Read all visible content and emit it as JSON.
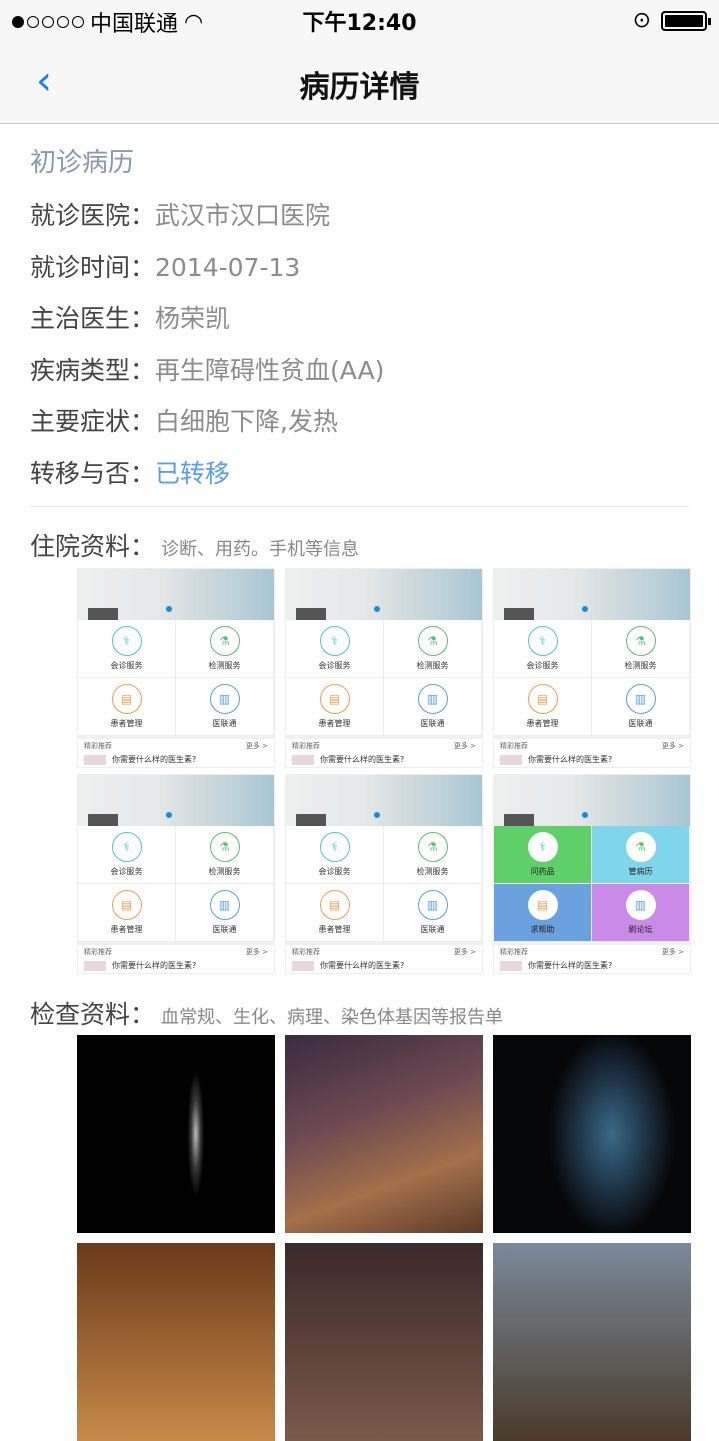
{
  "status": {
    "carrier": "中国联通",
    "time": "下午12:40",
    "signal_filled": 1,
    "signal_total": 5,
    "battery_percent": 100
  },
  "nav": {
    "title": "病历详情",
    "back_icon": "chevron-left-icon"
  },
  "record": {
    "section": "初诊病历",
    "fields": [
      {
        "label": "就诊医院：",
        "value": "武汉市汉口医院"
      },
      {
        "label": "就诊时间：",
        "value": "2014-07-13"
      },
      {
        "label": "主治医生：",
        "value": "杨荣凯"
      },
      {
        "label": "疾病类型：",
        "value": "再生障碍性贫血(AA)"
      },
      {
        "label": "主要症状：",
        "value": "白细胞下降,发热"
      },
      {
        "label": "转移与否：",
        "value": "已转移"
      }
    ]
  },
  "hospital": {
    "label": "住院资料：",
    "hint": "诊断、用药。手机等信息"
  },
  "thumb": {
    "tiles": [
      "会诊服务",
      "检测服务",
      "患者管理",
      "医联通"
    ],
    "color_tiles": [
      "问药品",
      "管病历",
      "求帮助",
      "刷论坛"
    ],
    "rec_title": "精彩推荐",
    "rec_more": "更多 >",
    "rec_question": "你需要什么样的医生素?"
  },
  "exam": {
    "label": "检查资料：",
    "hint": "血常规、生化、病理、染色体基因等报告单"
  },
  "colors": {
    "accent": "#1a7ff5",
    "tile_green": "#5fd068",
    "tile_cyan": "#7fd6ec",
    "tile_blue": "#6aa2e0",
    "tile_purple": "#c98ae8"
  }
}
